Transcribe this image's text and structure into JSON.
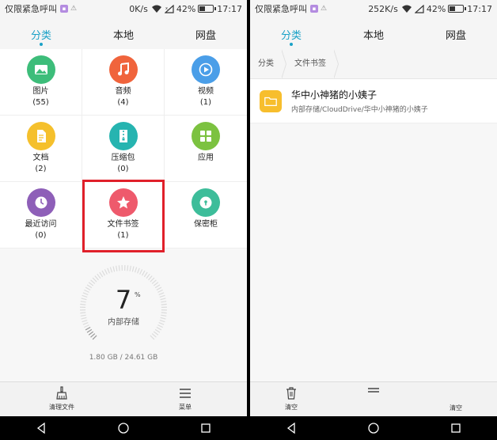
{
  "left": {
    "status": {
      "carrier": "仅限紧急呼叫",
      "speed": "0K/s",
      "battery": "42%",
      "time": "17:17"
    },
    "tabs": [
      {
        "label": "分类"
      },
      {
        "label": "本地"
      },
      {
        "label": "网盘"
      }
    ],
    "categories": [
      {
        "label": "图片",
        "count": "(55)",
        "color": "#3dbd7a",
        "icon": "image-icon"
      },
      {
        "label": "音频",
        "count": "(4)",
        "color": "#f0643c",
        "icon": "music-note-icon"
      },
      {
        "label": "视频",
        "count": "(1)",
        "color": "#4a9ee8",
        "icon": "play-icon"
      },
      {
        "label": "文档",
        "count": "(2)",
        "color": "#f5c02c",
        "icon": "document-icon"
      },
      {
        "label": "压缩包",
        "count": "(0)",
        "color": "#26b4b0",
        "icon": "zip-icon"
      },
      {
        "label": "应用",
        "count": "",
        "color": "#7cc240",
        "icon": "apps-icon"
      },
      {
        "label": "最近访问",
        "count": "(0)",
        "color": "#8e5fb8",
        "icon": "clock-icon"
      },
      {
        "label": "文件书签",
        "count": "(1)",
        "color": "#ee5a6c",
        "icon": "star-icon"
      },
      {
        "label": "保密柜",
        "count": "",
        "color": "#3dbd9a",
        "icon": "lock-icon"
      }
    ],
    "storage": {
      "percent": "7",
      "percent_unit": "%",
      "label": "内部存储",
      "size": "1.80 GB / 24.61 GB",
      "fraction": 0.07
    },
    "bottom": {
      "clean_label": "清理文件",
      "menu_label": "菜单"
    }
  },
  "right": {
    "status": {
      "carrier": "仅限紧急呼叫",
      "speed": "252K/s",
      "battery": "42%",
      "time": "17:17"
    },
    "tabs": [
      {
        "label": "分类"
      },
      {
        "label": "本地"
      },
      {
        "label": "网盘"
      }
    ],
    "breadcrumb": [
      "分类",
      "文件书签"
    ],
    "item": {
      "title": "华中小神猪的小姨子",
      "path": "内部存储/CloudDrive/华中小神猪的小姨子"
    },
    "bottom": {
      "clear_label": "清空",
      "clear_label_2": "清空"
    }
  }
}
